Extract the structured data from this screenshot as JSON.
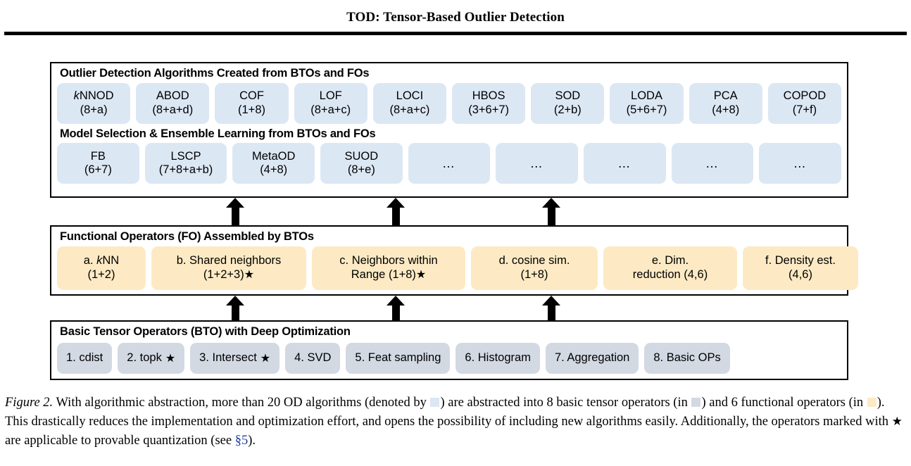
{
  "header": {
    "title_prefix": "TOD",
    "title_rest": ": Tensor-Based Outlier Detection"
  },
  "figure": {
    "panels": {
      "algorithms": {
        "title": "Outlier Detection Algorithms Created from BTOs and FOs",
        "items": [
          {
            "name": "kNNOD",
            "ops": "(8+a)",
            "italic_first": true
          },
          {
            "name": "ABOD",
            "ops": "(8+a+d)"
          },
          {
            "name": "COF",
            "ops": "(1+8)"
          },
          {
            "name": "LOF",
            "ops": "(8+a+c)"
          },
          {
            "name": "LOCI",
            "ops": "(8+a+c)"
          },
          {
            "name": "HBOS",
            "ops": "(3+6+7)"
          },
          {
            "name": "SOD",
            "ops": "(2+b)"
          },
          {
            "name": "LODA",
            "ops": "(5+6+7)"
          },
          {
            "name": "PCA",
            "ops": "(4+8)"
          },
          {
            "name": "COPOD",
            "ops": "(7+f)"
          }
        ]
      },
      "ensemble": {
        "title": "Model Selection & Ensemble Learning from BTOs and FOs",
        "items": [
          {
            "name": "FB",
            "ops": "(6+7)"
          },
          {
            "name": "LSCP",
            "ops": "(7+8+a+b)"
          },
          {
            "name": "MetaOD",
            "ops": "(4+8)"
          },
          {
            "name": "SUOD",
            "ops": "(8+e)"
          },
          {
            "name": "…",
            "ops": ""
          },
          {
            "name": "…",
            "ops": ""
          },
          {
            "name": "…",
            "ops": ""
          },
          {
            "name": "…",
            "ops": ""
          },
          {
            "name": "…",
            "ops": ""
          }
        ]
      },
      "functional_operators": {
        "title": "Functional Operators (FO) Assembled by BTOs",
        "items": [
          {
            "line1": "a. kNN",
            "line2": "(1+2)",
            "star": false,
            "italic_k": true
          },
          {
            "line1": "b. Shared neighbors",
            "line2": "(1+2+3)",
            "star": true
          },
          {
            "line1": "c. Neighbors within",
            "line2": "Range (1+8)",
            "star": true
          },
          {
            "line1": "d. cosine sim.",
            "line2": "(1+8)",
            "star": false
          },
          {
            "line1": "e. Dim.",
            "line2": "reduction (4,6)",
            "star": false
          },
          {
            "line1": "f. Density est.",
            "line2": "(4,6)",
            "star": false
          }
        ]
      },
      "basic_tensor_operators": {
        "title": "Basic Tensor Operators (BTO) with Deep Optimization",
        "items": [
          {
            "label": "1. cdist",
            "star": false
          },
          {
            "label": "2. topk",
            "star": true
          },
          {
            "label": "3. Intersect",
            "star": true
          },
          {
            "label": "4. SVD",
            "star": false
          },
          {
            "label": "5. Feat sampling",
            "star": false
          },
          {
            "label": "6. Histogram",
            "star": false
          },
          {
            "label": "7. Aggregation",
            "star": false
          },
          {
            "label": "8. Basic OPs",
            "star": false
          }
        ]
      }
    }
  },
  "caption": {
    "figure_label": "Figure 2.",
    "part1": " With algorithmic abstraction, more than 20 OD algorithms (denoted by ",
    "part2": ") are abstracted into 8 basic tensor operators (in ",
    "part3": ") and 6 functional operators (in ",
    "part4": "). This drastically reduces the implementation and optimization effort, and opens the possibility of including new algorithms easily. Additionally, the operators marked with ",
    "star_glyph": "★",
    "part5": " are applicable to provable quantization (see ",
    "section_ref": "§5",
    "part6": ")."
  },
  "colors": {
    "algorithm_pill": "#dce7f4",
    "functional_pill": "#fdeac4",
    "basic_pill": "#d3d9e3",
    "link": "#1a3fa0",
    "border": "#000000"
  }
}
